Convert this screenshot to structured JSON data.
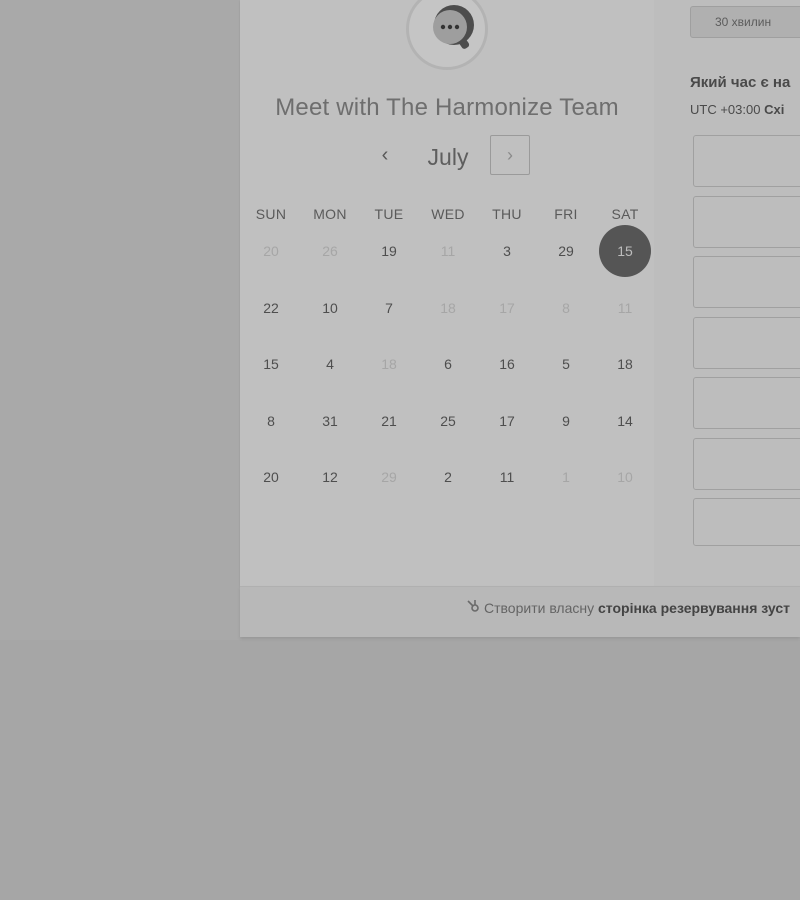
{
  "meeting": {
    "title": "Meet with The Harmonize Team"
  },
  "calendar": {
    "month": "July",
    "prev_icon": "chevron-left-icon",
    "next_icon": "chevron-right-icon",
    "weekdays": [
      "SUN",
      "MON",
      "TUE",
      "WED",
      "THU",
      "FRI",
      "SAT"
    ],
    "weeks": [
      [
        {
          "d": "20",
          "s": "off"
        },
        {
          "d": "26",
          "s": "off"
        },
        {
          "d": "19",
          "s": "on"
        },
        {
          "d": "11",
          "s": "off"
        },
        {
          "d": "3",
          "s": "on"
        },
        {
          "d": "29",
          "s": "on"
        },
        {
          "d": "15",
          "s": "selected"
        }
      ],
      [
        {
          "d": "22",
          "s": "on"
        },
        {
          "d": "10",
          "s": "on"
        },
        {
          "d": "7",
          "s": "on"
        },
        {
          "d": "18",
          "s": "off"
        },
        {
          "d": "17",
          "s": "off"
        },
        {
          "d": "8",
          "s": "off"
        },
        {
          "d": "11",
          "s": "off"
        }
      ],
      [
        {
          "d": "15",
          "s": "on"
        },
        {
          "d": "4",
          "s": "on"
        },
        {
          "d": "18",
          "s": "off"
        },
        {
          "d": "6",
          "s": "on"
        },
        {
          "d": "16",
          "s": "on"
        },
        {
          "d": "5",
          "s": "on"
        },
        {
          "d": "18",
          "s": "on"
        }
      ],
      [
        {
          "d": "8",
          "s": "on"
        },
        {
          "d": "31",
          "s": "on"
        },
        {
          "d": "21",
          "s": "on"
        },
        {
          "d": "25",
          "s": "on"
        },
        {
          "d": "17",
          "s": "on"
        },
        {
          "d": "9",
          "s": "on"
        },
        {
          "d": "14",
          "s": "on"
        }
      ],
      [
        {
          "d": "20",
          "s": "on"
        },
        {
          "d": "12",
          "s": "on"
        },
        {
          "d": "29",
          "s": "off"
        },
        {
          "d": "2",
          "s": "on"
        },
        {
          "d": "11",
          "s": "on"
        },
        {
          "d": "1",
          "s": "off"
        },
        {
          "d": "10",
          "s": "off"
        }
      ]
    ]
  },
  "booking": {
    "duration_label": "30 хвилин",
    "question": "Який час є на",
    "timezone_prefix": "UTC +03:00",
    "timezone_name": "Схі"
  },
  "footer": {
    "logo_icon": "hubspot-sprocket-icon",
    "prefix": "Створити власну",
    "link": "сторінка резервування зуст"
  },
  "colors": {
    "overlay": "#a6a6a6",
    "card": "#c0c0c0",
    "selected_day": "#555555"
  }
}
